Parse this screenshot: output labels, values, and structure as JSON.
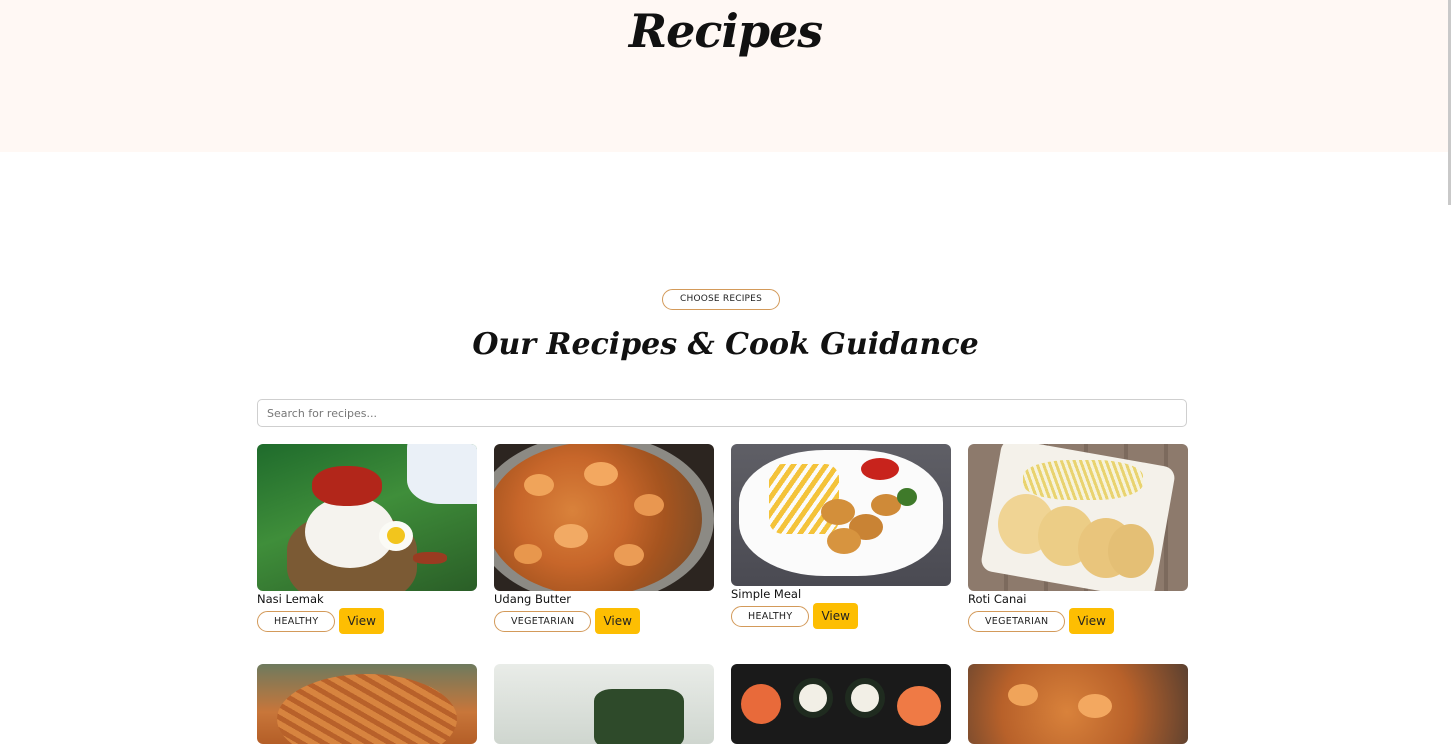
{
  "hero": {
    "title": "Recipes"
  },
  "section": {
    "eyebrow": "CHOOSE RECIPES",
    "title": "Our Recipes & Cook Guidance"
  },
  "search": {
    "placeholder": "Search for recipes..."
  },
  "view_label": "View",
  "recipes": [
    {
      "name": "Nasi Lemak",
      "tag": "HEALTHY"
    },
    {
      "name": "Udang Butter",
      "tag": "VEGETARIAN"
    },
    {
      "name": "Simple Meal",
      "tag": "HEALTHY"
    },
    {
      "name": "Roti Canai",
      "tag": "VEGETARIAN"
    }
  ]
}
